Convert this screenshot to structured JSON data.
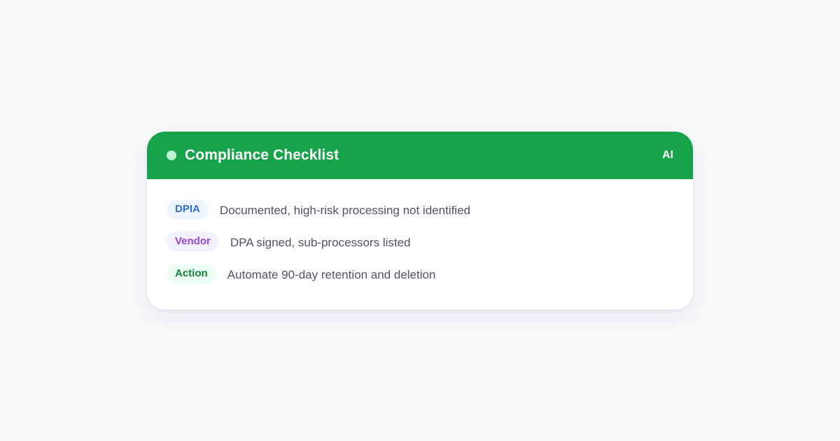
{
  "card": {
    "title": "Compliance Checklist",
    "badge": "AI",
    "status_dot_color": "#bbf7d0",
    "header_color": "#16a34a",
    "items": [
      {
        "tag": "DPIA",
        "tag_color": "#2f6fd6",
        "text": "Documented, high-risk processing not identified"
      },
      {
        "tag": "Vendor",
        "tag_color": "#9149d6",
        "text": "DPA signed, sub-processors listed"
      },
      {
        "tag": "Action",
        "tag_color": "#15803d",
        "text": "Automate 90-day retention and deletion"
      }
    ]
  }
}
